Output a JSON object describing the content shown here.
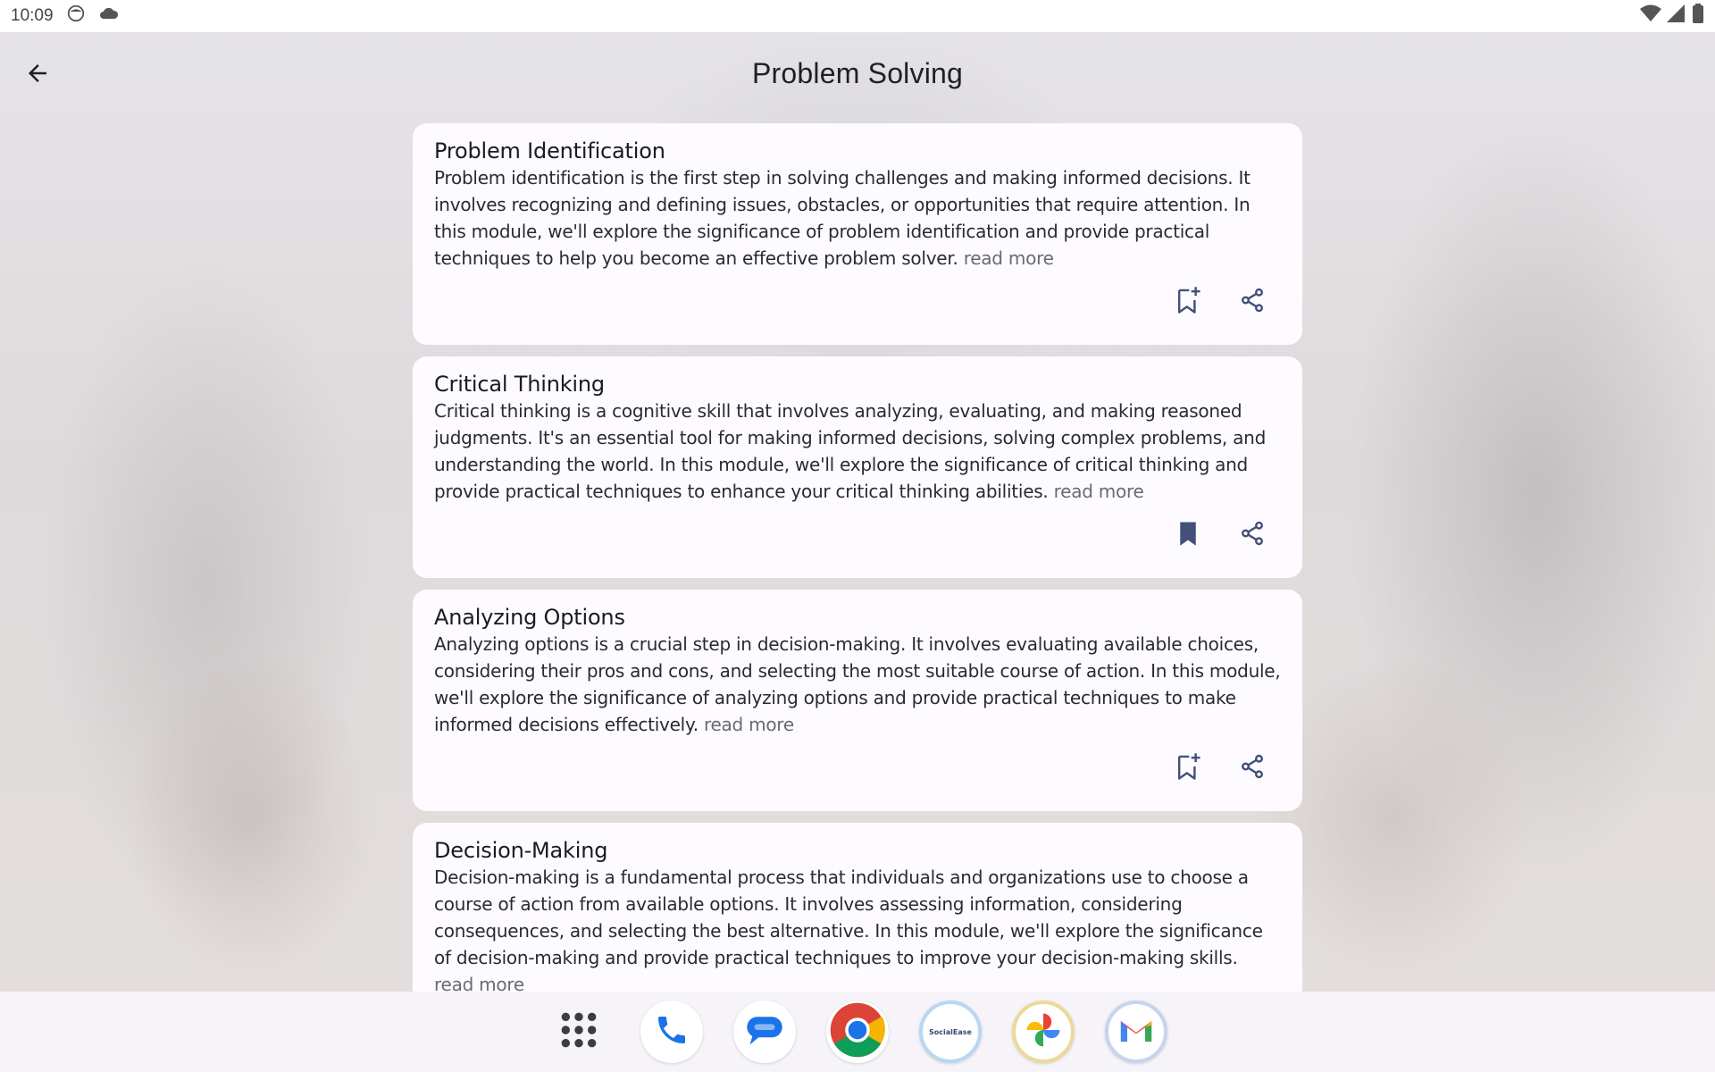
{
  "status_bar": {
    "time": "10:09",
    "left_icons": [
      "face-icon",
      "cloud-icon"
    ],
    "right_icons": [
      "wifi-icon",
      "signal-icon",
      "battery-icon"
    ]
  },
  "header": {
    "title": "Problem Solving",
    "back_icon": "arrow-left-icon"
  },
  "cards": [
    {
      "title": "Problem Identification",
      "description": "Problem identification is the first step in solving challenges and making informed decisions. It involves recognizing and defining issues, obstacles, or opportunities that require attention. In this module, we'll explore the significance of problem identification and provide practical techniques to help you become an effective problem solver.",
      "read_more": "read more",
      "bookmarked": false
    },
    {
      "title": "Critical Thinking",
      "description": "Critical thinking is a cognitive skill that involves analyzing, evaluating, and making reasoned judgments. It's an essential tool for making informed decisions, solving complex problems, and understanding the world. In this module, we'll explore the significance of critical thinking and provide practical techniques to enhance your critical thinking abilities.",
      "read_more": "read more",
      "bookmarked": true
    },
    {
      "title": "Analyzing Options",
      "description": "Analyzing options is a crucial step in decision-making. It involves evaluating available choices, considering their pros and cons, and selecting the most suitable course of action. In this module, we'll explore the significance of analyzing options and provide practical techniques to make informed decisions effectively.",
      "read_more": "read more",
      "bookmarked": false
    },
    {
      "title": "Decision-Making",
      "description": "Decision-making is a fundamental process that individuals and organizations use to choose a course of action from available options. It involves assessing information, considering consequences, and selecting the best alternative. In this module, we'll explore the significance of decision-making and provide practical techniques to improve your decision-making skills.",
      "read_more": "read more",
      "bookmarked": false
    }
  ],
  "dock": {
    "apps": [
      "app-drawer-icon",
      "phone-icon",
      "messages-icon",
      "chrome-icon",
      "socialease-icon",
      "photos-icon",
      "gmail-icon"
    ],
    "socialease_label": "SocialEase"
  },
  "colors": {
    "icon": "#44507a",
    "card_bg": "#fdfbff",
    "read_more": "#6b6a72"
  }
}
